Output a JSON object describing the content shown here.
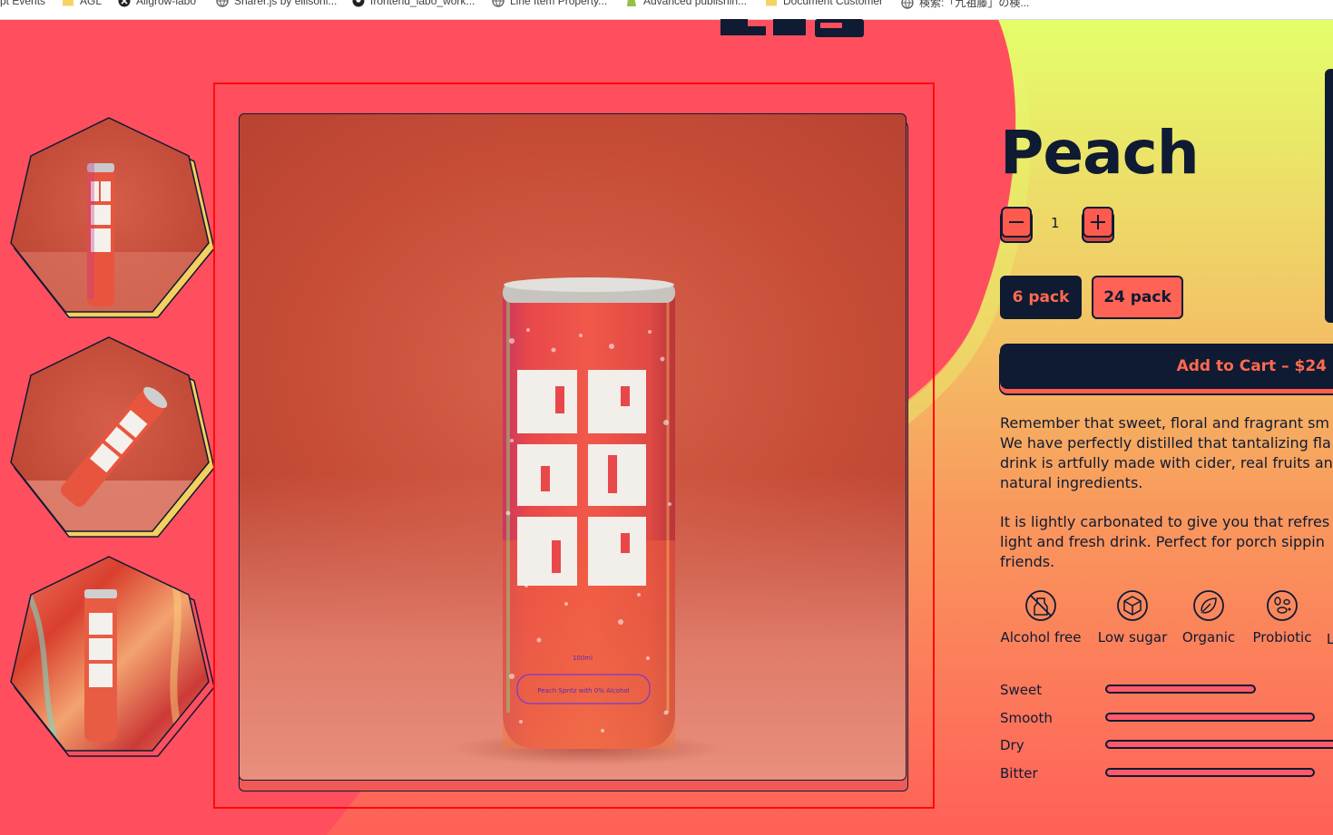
{
  "bookmarks": [
    {
      "label": "pt Events",
      "icon": "none"
    },
    {
      "label": "AGL",
      "icon": "folder-icon"
    },
    {
      "label": "Allgrow-labo",
      "icon": "x-logo-icon"
    },
    {
      "label": "Sharer.js by ellisonl...",
      "icon": "globe-icon"
    },
    {
      "label": "frontend_labo_work...",
      "icon": "github-icon"
    },
    {
      "label": "Line Item Property...",
      "icon": "globe-icon"
    },
    {
      "label": "Advanced publishin...",
      "icon": "shopify-icon"
    },
    {
      "label": "Document Customer",
      "icon": "folder-icon"
    },
    {
      "label": "検索:「九祖藤」の検...",
      "icon": "globe-icon"
    }
  ],
  "product": {
    "title": "Peach",
    "quantity": "1",
    "packs": [
      "6 pack",
      "24 pack"
    ],
    "selected_pack": "6 pack",
    "add_to_cart": "Add to Cart – $24",
    "description": [
      [
        "Remember that sweet, floral and fragrant sm",
        "We have perfectly distilled that tantalizing fla",
        "drink is artfully made with cider, real fruits an",
        "natural ingredients."
      ],
      [
        "It is lightly carbonated to give you that refres",
        "light and fresh drink. Perfect for porch sippin",
        "friends."
      ]
    ],
    "features": [
      {
        "label": "Alcohol free",
        "icon": "no-alcohol-icon"
      },
      {
        "label": "Low sugar",
        "icon": "sugar-cube-icon"
      },
      {
        "label": "Organic",
        "icon": "leaf-icon"
      },
      {
        "label": "Probiotic",
        "icon": "probiotic-icon"
      },
      {
        "label": "L",
        "icon": "none"
      }
    ],
    "taste_profile": [
      {
        "label": "Sweet",
        "level": 0.66
      },
      {
        "label": "Smooth",
        "level": 0.92
      },
      {
        "label": "Dry",
        "level": 1.0
      },
      {
        "label": "Bitter",
        "level": 0.92
      }
    ]
  },
  "can": {
    "volume": "100ml",
    "badge": "Peach Spritz with 0% Alcohol"
  },
  "colors": {
    "navy": "#0f1a33",
    "coral": "#ff4f5e",
    "lime": "#e2ff6b",
    "orange": "#ff6a4e",
    "selection": "#ff0a0a"
  }
}
